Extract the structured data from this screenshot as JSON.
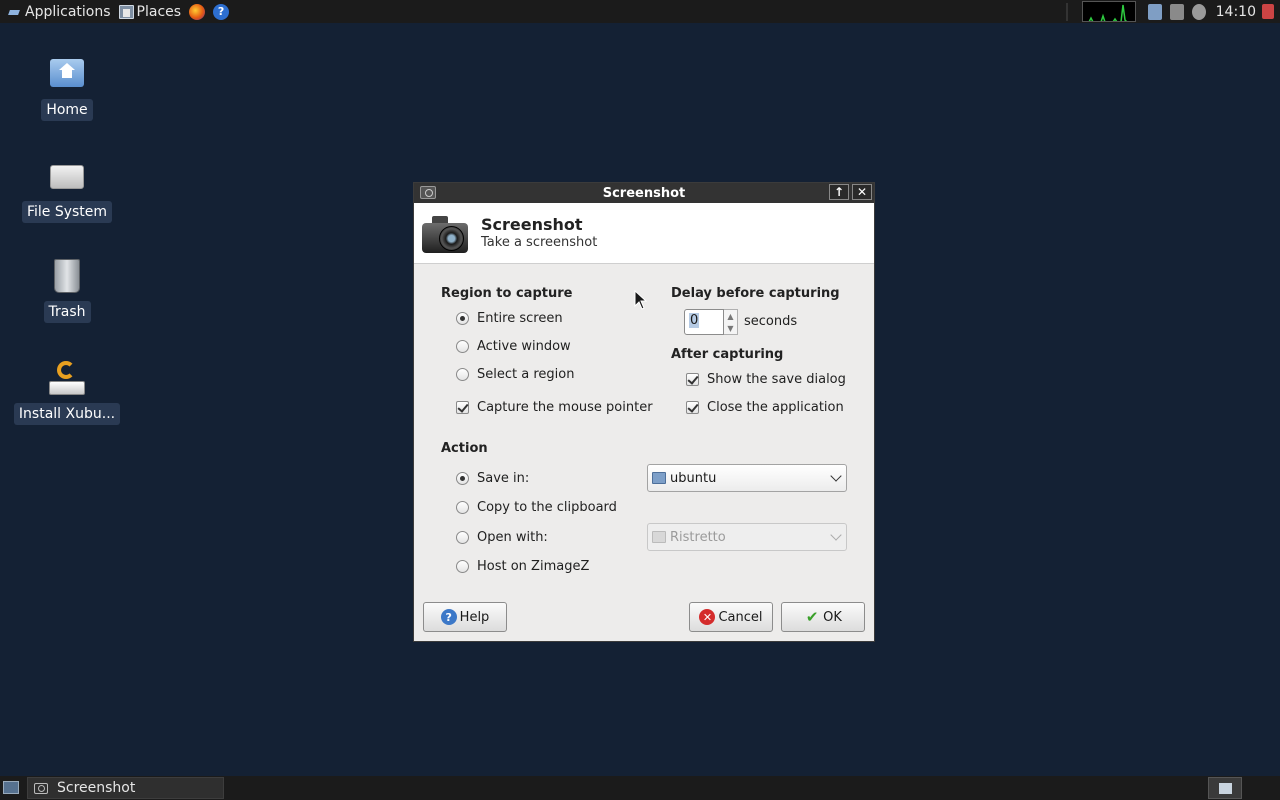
{
  "top_panel": {
    "applications_label": "Applications",
    "places_label": "Places",
    "clock": "14:10"
  },
  "desktop": {
    "icons": [
      {
        "label": "Home"
      },
      {
        "label": "File System"
      },
      {
        "label": "Trash"
      },
      {
        "label": "Install Xubu..."
      }
    ]
  },
  "dialog": {
    "window_title": "Screenshot",
    "header_title": "Screenshot",
    "header_subtitle": "Take a screenshot",
    "region": {
      "heading": "Region to capture",
      "options": [
        "Entire screen",
        "Active window",
        "Select a region"
      ],
      "selected": "Entire screen",
      "capture_pointer_label": "Capture the mouse pointer",
      "capture_pointer_checked": true
    },
    "delay": {
      "heading": "Delay before capturing",
      "value": "0",
      "unit": "seconds"
    },
    "after": {
      "heading": "After capturing",
      "show_save_dialog": "Show the save dialog",
      "close_application": "Close the application",
      "show_save_checked": true,
      "close_app_checked": true
    },
    "action": {
      "heading": "Action",
      "save_in_label": "Save in:",
      "save_in_value": "ubuntu",
      "copy_label": "Copy to the clipboard",
      "open_with_label": "Open with:",
      "open_with_value": "Ristretto",
      "host_label": "Host on ZimageZ",
      "selected": "Save in:"
    },
    "buttons": {
      "help": "Help",
      "cancel": "Cancel",
      "ok": "OK"
    }
  },
  "taskbar": {
    "task_label": "Screenshot"
  },
  "colors": {
    "desktop_bg": "#142134",
    "panel_bg": "#1b1b1b",
    "dialog_bg": "#edeceb"
  }
}
